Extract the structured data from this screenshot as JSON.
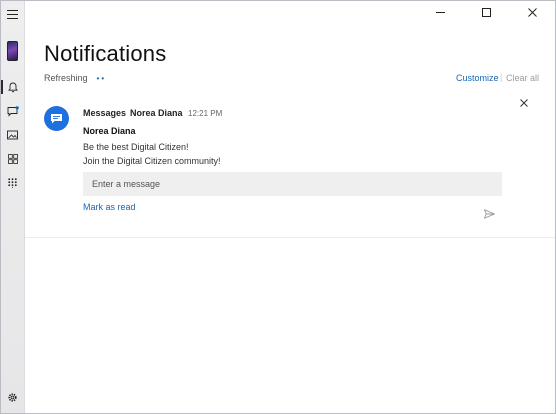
{
  "window": {
    "minimize_glyph": "—",
    "maximize_glyph": "☐",
    "close_glyph": "✕"
  },
  "sidebar": {
    "items": [
      {
        "icon": "hamburger-menu-icon"
      },
      {
        "icon": "phone-thumbnail"
      },
      {
        "icon": "bell-icon",
        "active": true
      },
      {
        "icon": "messages-icon"
      },
      {
        "icon": "photos-icon"
      },
      {
        "icon": "apps-icon"
      },
      {
        "icon": "dialpad-icon"
      },
      {
        "icon": "gear-icon"
      }
    ]
  },
  "header": {
    "title": "Notifications",
    "status": "Refreshing",
    "customize": "Customize",
    "separator": "|",
    "clear_all": "Clear all"
  },
  "notification": {
    "app": "Messages",
    "sender_header": "Norea Diana",
    "time": "12:21 PM",
    "sender": "Norea Diana",
    "lines": [
      "Be the best Digital Citizen!",
      "Join the Digital Citizen community!"
    ],
    "reply_placeholder": "Enter a message",
    "mark_as_read": "Mark as read",
    "dismiss_glyph": "✕"
  },
  "colors": {
    "accent": "#1767b5",
    "app_icon": "#1e6fe0",
    "reply_bg": "#efefef"
  }
}
